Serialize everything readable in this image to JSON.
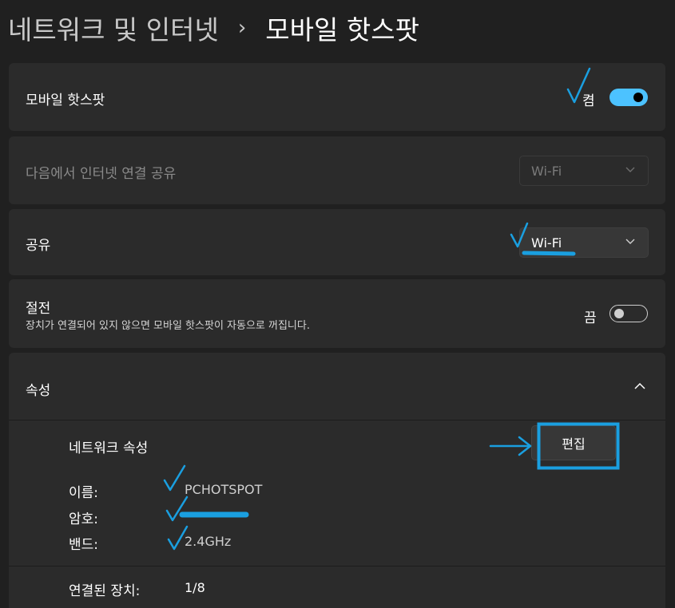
{
  "breadcrumb": {
    "parent": "네트워크 및 인터넷",
    "separator": "›",
    "current": "모바일 핫스팟"
  },
  "hotspot": {
    "label": "모바일 핫스팟",
    "state_text": "켬",
    "enabled": true
  },
  "share_from": {
    "label": "다음에서 인터넷 연결 공유",
    "value": "Wi-Fi",
    "disabled": true
  },
  "share_over": {
    "label": "공유",
    "value": "Wi-Fi"
  },
  "power_saving": {
    "label": "절전",
    "description": "장치가 연결되어 있지 않으면 모바일 핫스팟이 자동으로 꺼집니다.",
    "state_text": "끔",
    "enabled": false
  },
  "properties": {
    "label": "속성",
    "expanded": true,
    "section_title": "네트워크 속성",
    "edit_label": "편집",
    "name_key": "이름:",
    "name_value": "PCHOTSPOT",
    "password_key": "암호:",
    "band_key": "밴드:",
    "band_value": "2.4GHz",
    "connected_key": "연결된 장치:",
    "connected_value": "1/8"
  },
  "colors": {
    "background": "#202020",
    "card": "#2b2b2b",
    "accent": "#4cc2ff",
    "annotation": "#1a9fe0"
  },
  "icons": [
    "chevron-right-icon",
    "chevron-down-icon",
    "chevron-up-icon"
  ]
}
